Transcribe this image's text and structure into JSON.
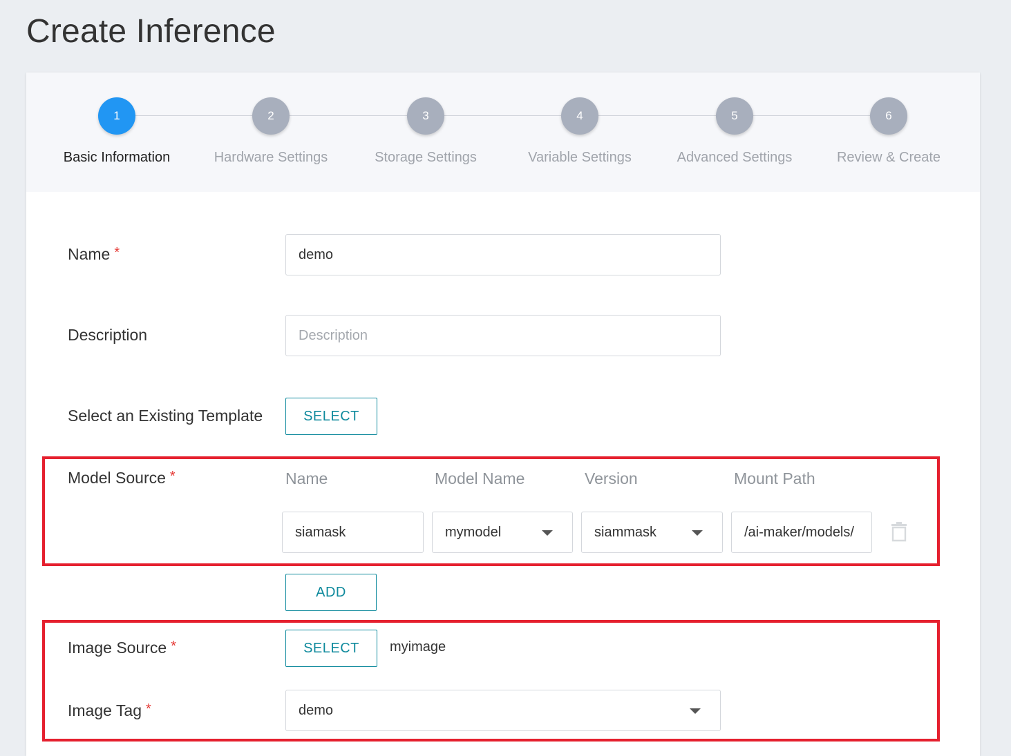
{
  "page": {
    "title": "Create Inference"
  },
  "stepper": {
    "steps": [
      {
        "number": "1",
        "label": "Basic Information",
        "active": true
      },
      {
        "number": "2",
        "label": "Hardware Settings",
        "active": false
      },
      {
        "number": "3",
        "label": "Storage Settings",
        "active": false
      },
      {
        "number": "4",
        "label": "Variable Settings",
        "active": false
      },
      {
        "number": "5",
        "label": "Advanced Settings",
        "active": false
      },
      {
        "number": "6",
        "label": "Review & Create",
        "active": false
      }
    ]
  },
  "form": {
    "required_mark": "*",
    "name": {
      "label": "Name",
      "value": "demo"
    },
    "description": {
      "label": "Description",
      "placeholder": "Description",
      "value": ""
    },
    "template": {
      "label": "Select an Existing Template",
      "button": "SELECT"
    },
    "model_source": {
      "label": "Model Source",
      "columns": {
        "name": "Name",
        "model_name": "Model Name",
        "version": "Version",
        "mount_path": "Mount Path"
      },
      "row": {
        "name": "siamask",
        "model_name": "mymodel",
        "version": "siammask",
        "mount_path": "/ai-maker/models/"
      },
      "add_button": "ADD"
    },
    "image_source": {
      "label": "Image Source",
      "button": "SELECT",
      "value": "myimage"
    },
    "image_tag": {
      "label": "Image Tag",
      "value": "demo"
    }
  },
  "colors": {
    "accent": "#0f8a9d",
    "active_step": "#2196f3",
    "highlight_box": "#e5202e",
    "required": "#e53935"
  }
}
